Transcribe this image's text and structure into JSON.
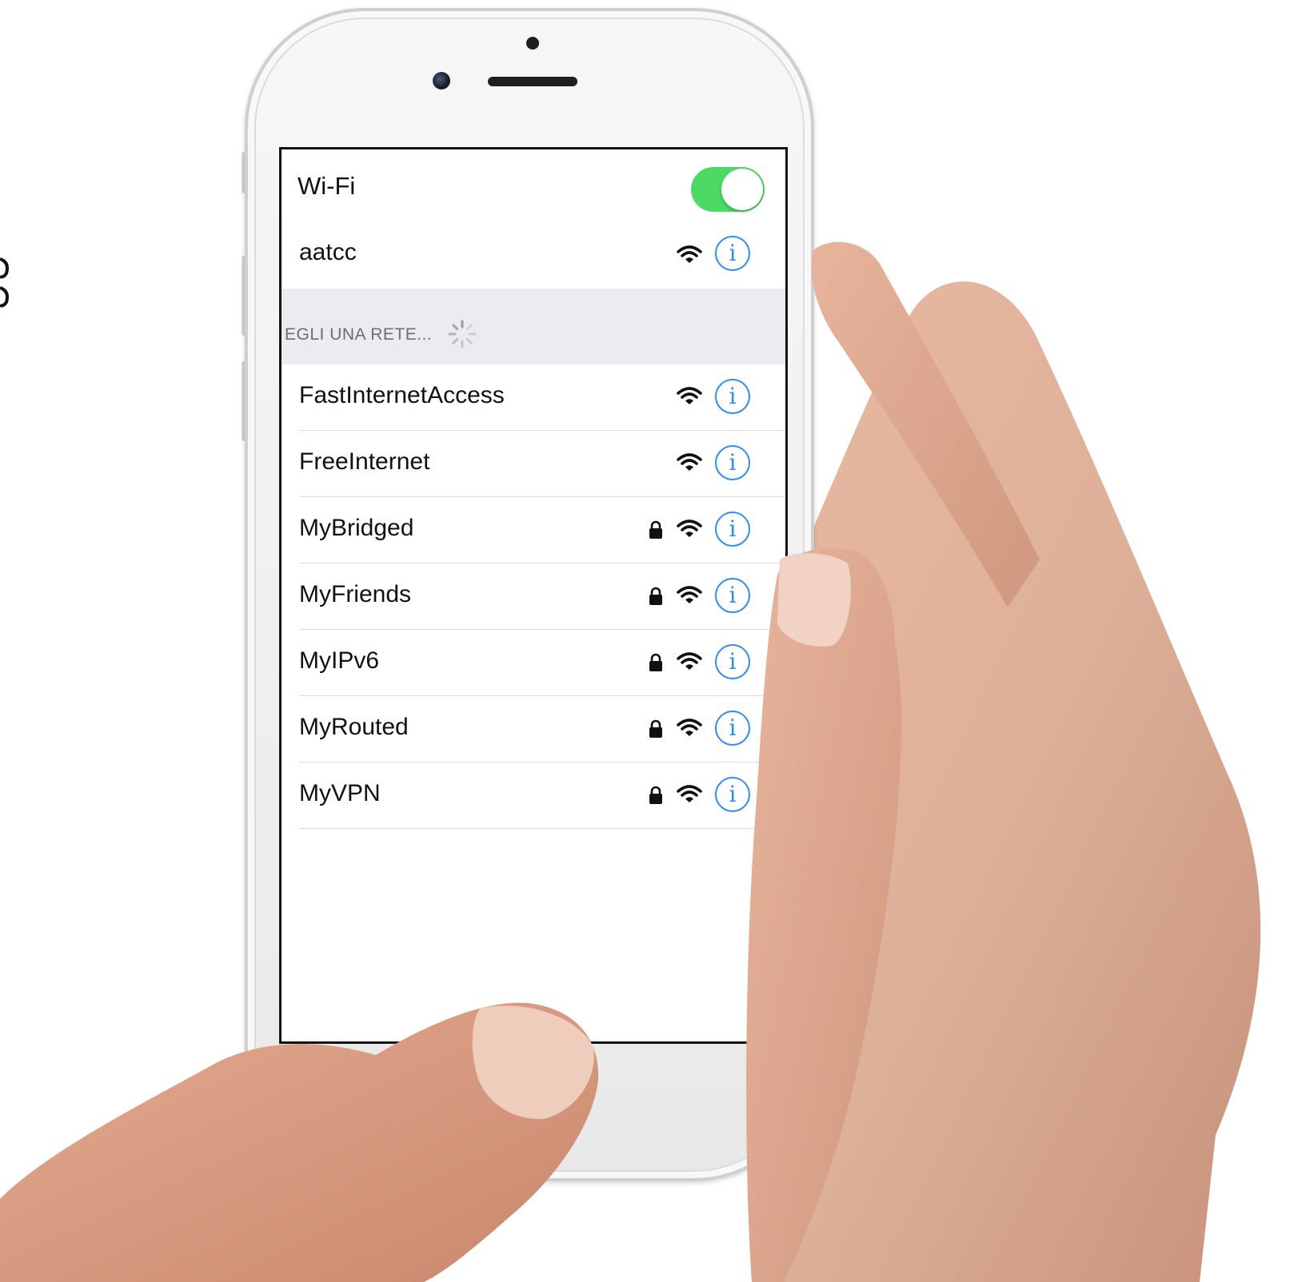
{
  "settings": {
    "wifi_label": "Wi-Fi",
    "wifi_enabled": true,
    "toggle_color": "#4cd964",
    "current_network": {
      "name": "aatcc",
      "secured": false,
      "signal_icon": "wifi-signal-icon",
      "info_icon": "info-circle-icon"
    },
    "section_header": "EGLI UNA RETE...",
    "section_spinner_icon": "loading-spinner-icon",
    "info_glyph": "i",
    "accent_color": "#2f8cf0",
    "networks": [
      {
        "name": "FastInternetAccess",
        "secured": false
      },
      {
        "name": "FreeInternet",
        "secured": false
      },
      {
        "name": "MyBridged",
        "secured": true
      },
      {
        "name": "MyFriends",
        "secured": true
      },
      {
        "name": "MyIPv6",
        "secured": true
      },
      {
        "name": "MyRouted",
        "secured": true
      },
      {
        "name": "MyVPN",
        "secured": true
      }
    ]
  }
}
